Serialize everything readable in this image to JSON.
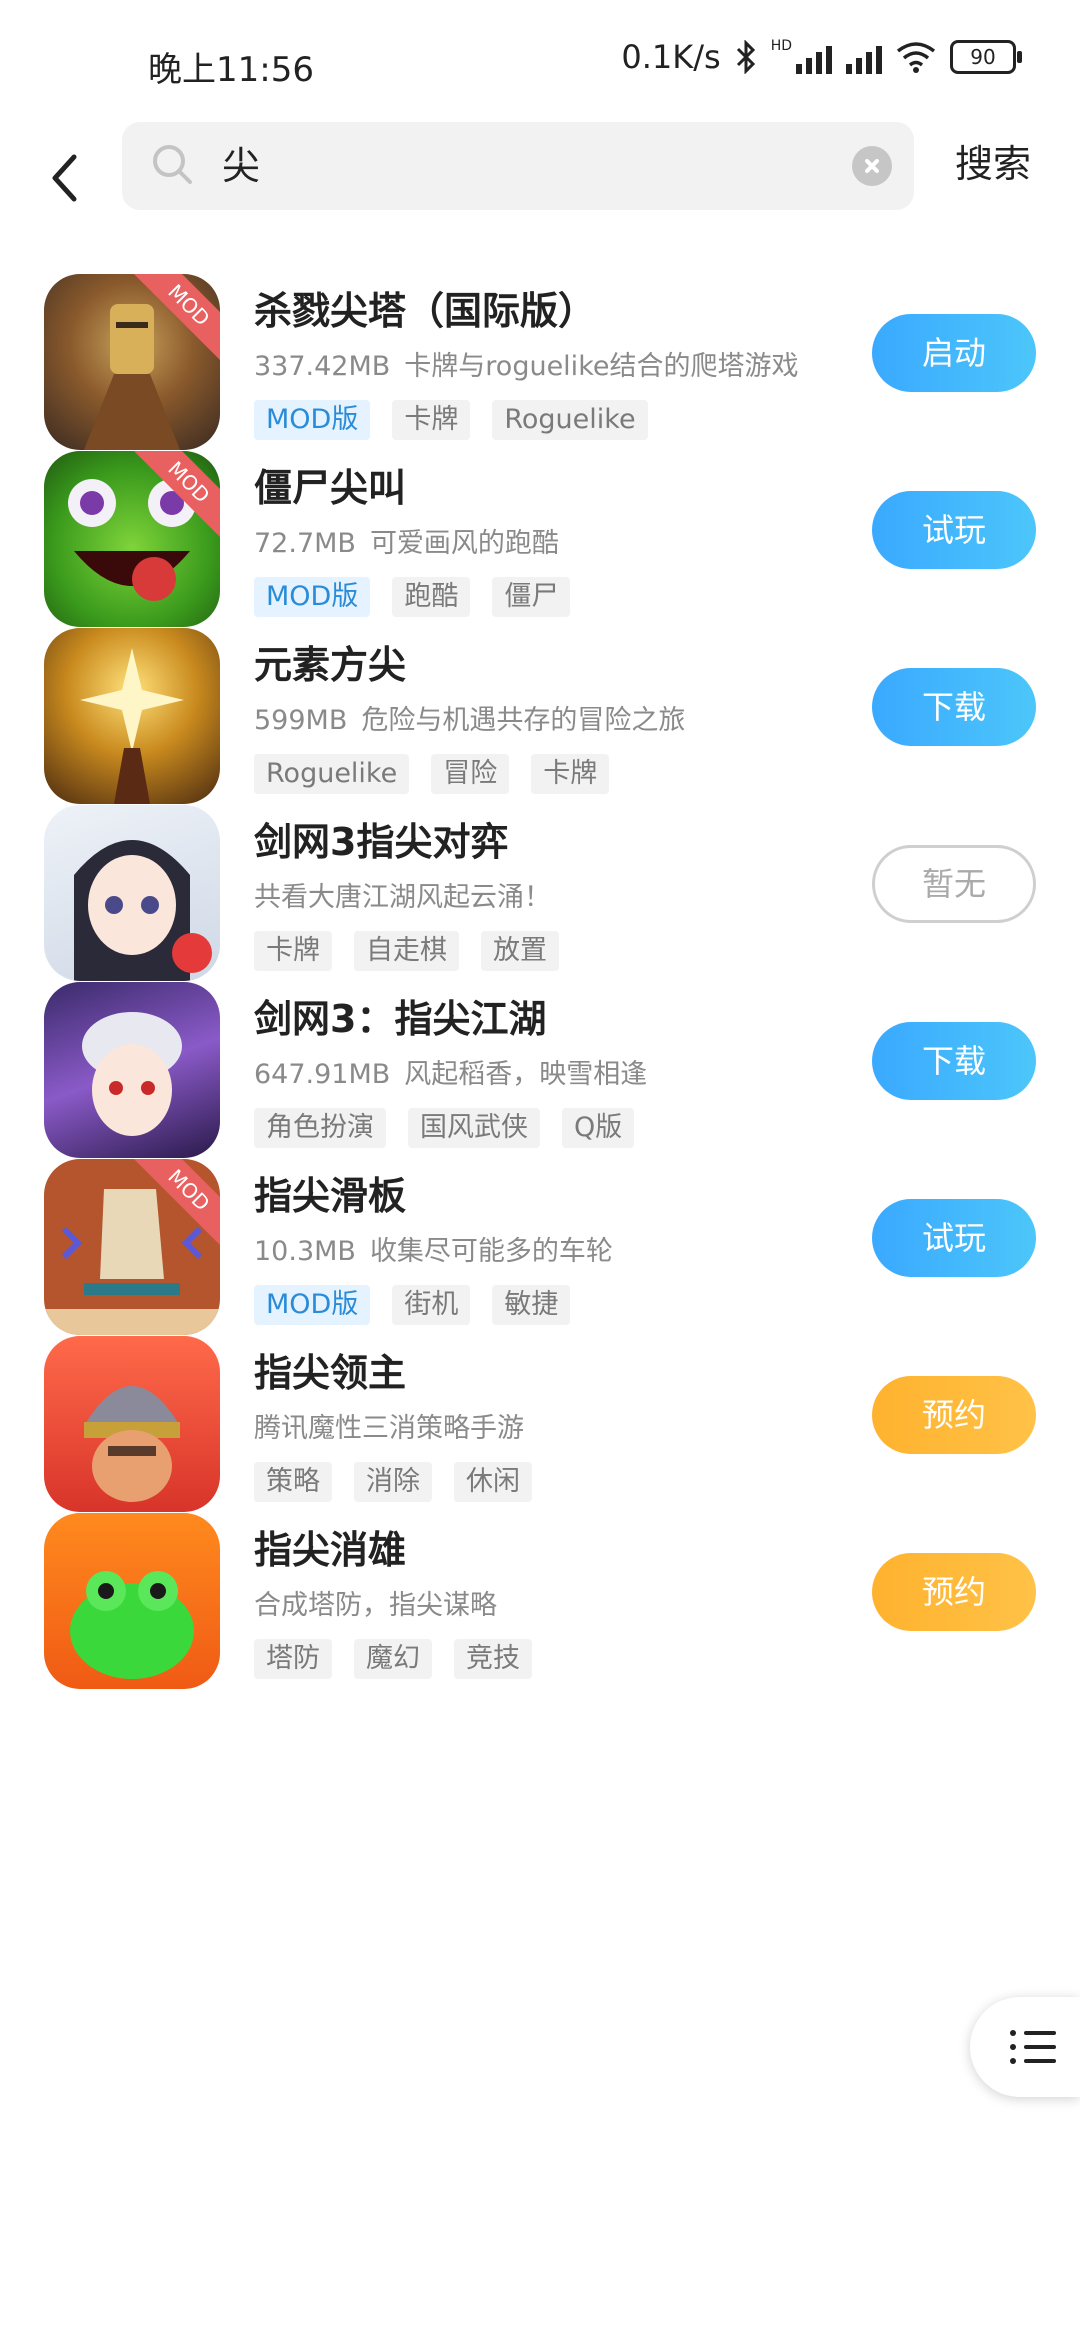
{
  "status_bar": {
    "time": "晚上11:56",
    "net_speed": "0.1K/s",
    "hd_label": "HD",
    "battery": "90"
  },
  "search": {
    "query": "尖",
    "submit_label": "搜索"
  },
  "apps": [
    {
      "name": "杀戮尖塔（国际版）",
      "size": "337.42MB",
      "desc": "卡牌与roguelike结合的爬塔游戏",
      "mod_badge": "MOD",
      "tags": [
        "MOD版",
        "卡牌",
        "Roguelike"
      ],
      "action": "启动"
    },
    {
      "name": "僵尸尖叫",
      "size": "72.7MB",
      "desc": "可爱画风的跑酷",
      "mod_badge": "MOD",
      "tags": [
        "MOD版",
        "跑酷",
        "僵尸"
      ],
      "action": "试玩"
    },
    {
      "name": "元素方尖",
      "size": "599MB",
      "desc": "危险与机遇共存的冒险之旅",
      "tags": [
        "Roguelike",
        "冒险",
        "卡牌"
      ],
      "action": "下载"
    },
    {
      "name": "剑网3指尖对弈",
      "size": "",
      "desc": "共看大唐江湖风起云涌！",
      "tags": [
        "卡牌",
        "自走棋",
        "放置"
      ],
      "action": "暂无"
    },
    {
      "name": "剑网3：指尖江湖",
      "size": "647.91MB",
      "desc": "风起稻香，映雪相逢",
      "tags": [
        "角色扮演",
        "国风武侠",
        "Q版"
      ],
      "action": "下载"
    },
    {
      "name": "指尖滑板",
      "size": "10.3MB",
      "desc": "收集尽可能多的车轮",
      "mod_badge": "MOD",
      "tags": [
        "MOD版",
        "街机",
        "敏捷"
      ],
      "action": "试玩"
    },
    {
      "name": "指尖领主",
      "size": "",
      "desc": "腾讯魔性三消策略手游",
      "tags": [
        "策略",
        "消除",
        "休闲"
      ],
      "action": "预约"
    },
    {
      "name": "指尖消雄",
      "size": "",
      "desc": "合成塔防，指尖谋略",
      "tags": [
        "塔防",
        "魔幻",
        "竞技"
      ],
      "action": "预约"
    }
  ],
  "colors": {
    "accent_blue": "#3aa9ff",
    "accent_orange": "#ffb22e",
    "mod_tag_text": "#2a8cd8"
  }
}
